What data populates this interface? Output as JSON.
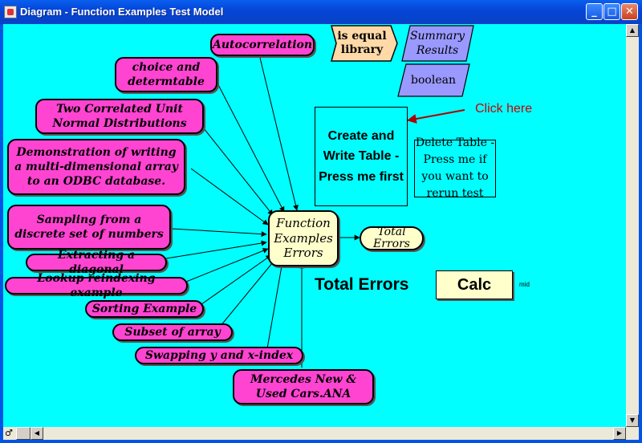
{
  "window": {
    "title": "Diagram - Function Examples Test Model",
    "minimize_label": "_",
    "maximize_label": "□",
    "close_label": "✕"
  },
  "nodes": {
    "autocorrelation": "Autocorrelation",
    "choice_determtable": "choice and determtable",
    "two_correlated": "Two Correlated Unit Normal Distributions",
    "odbc_demo": "Demonstration of writing a multi-dimensional array to an ODBC  database.",
    "sampling": "Sampling from a discrete set of numbers",
    "extracting_diagonal": "Extracting a diagonal",
    "lookup_reindexing": "Lookup reindexing example",
    "sorting_example": "Sorting Example",
    "subset_array": "Subset of array",
    "swapping": "Swapping y and x-index",
    "mercedes": "Mercedes New & Used Cars.ANA",
    "function_examples_errors": "Function Examples Errors",
    "total_errors_node": "Total Errors",
    "is_equal_library": "is equal library",
    "summary_results": "Summary Results",
    "boolean": "boolean"
  },
  "buttons": {
    "create_write_table": "Create and Write Table - Press me first",
    "delete_table": "Delete Table - Press me if you want to rerun test",
    "calc": "Calc"
  },
  "annotations": {
    "click_here": "Click here",
    "total_errors_label": "Total Errors",
    "mid_label": "mid"
  },
  "scrollbars": {
    "up_arrow": "▲",
    "down_arrow": "▼",
    "left_arrow": "◀",
    "right_arrow": "▶",
    "h_icon": "♂"
  },
  "colors": {
    "canvas": "#00ffff",
    "pink_node": "#ff44d2",
    "yellow_node": "#ffffcc",
    "library": "#ffd9a8",
    "purple_module": "#9999ff",
    "click_here": "#cc0000"
  }
}
